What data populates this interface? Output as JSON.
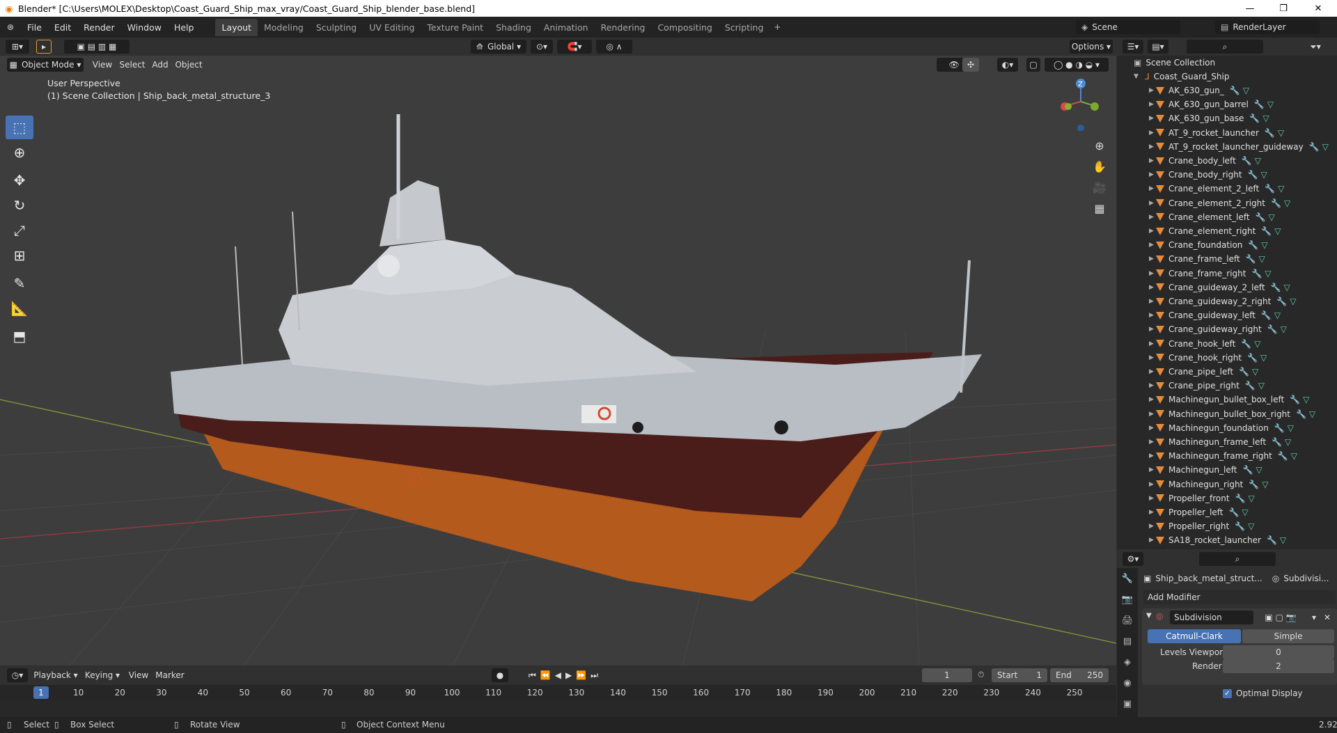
{
  "window": {
    "title": "Blender* [C:\\Users\\MOLEX\\Desktop\\Coast_Guard_Ship_max_vray/Coast_Guard_Ship_blender_base.blend]"
  },
  "menus": [
    "File",
    "Edit",
    "Render",
    "Window",
    "Help"
  ],
  "workspaces": [
    "Layout",
    "Modeling",
    "Sculpting",
    "UV Editing",
    "Texture Paint",
    "Shading",
    "Animation",
    "Rendering",
    "Compositing",
    "Scripting"
  ],
  "active_workspace": "Layout",
  "scene": {
    "name": "Scene",
    "render_layer": "RenderLayer"
  },
  "viewport_header": {
    "transform_orientation": "Global",
    "options": "Options",
    "mode": "Object Mode",
    "menus": [
      "View",
      "Select",
      "Add",
      "Object"
    ]
  },
  "viewport": {
    "perspective": "User Perspective",
    "collection_info": "(1) Scene Collection | Ship_back_metal_structure_3",
    "gizmo_axis": "Z"
  },
  "outliner": {
    "root": "Scene Collection",
    "collection": "Coast_Guard_Ship",
    "items": [
      "AK_630_gun_",
      "AK_630_gun_barrel",
      "AK_630_gun_base",
      "AT_9_rocket_launcher",
      "AT_9_rocket_launcher_guideway",
      "Crane_body_left",
      "Crane_body_right",
      "Crane_element_2_left",
      "Crane_element_2_right",
      "Crane_element_left",
      "Crane_element_right",
      "Crane_foundation",
      "Crane_frame_left",
      "Crane_frame_right",
      "Crane_guideway_2_left",
      "Crane_guideway_2_right",
      "Crane_guideway_left",
      "Crane_guideway_right",
      "Crane_hook_left",
      "Crane_hook_right",
      "Crane_pipe_left",
      "Crane_pipe_right",
      "Machinegun_bullet_box_left",
      "Machinegun_bullet_box_right",
      "Machinegun_foundation",
      "Machinegun_frame_left",
      "Machinegun_frame_right",
      "Machinegun_left",
      "Machinegun_right",
      "Propeller_front",
      "Propeller_left",
      "Propeller_right",
      "SA18_rocket_launcher"
    ]
  },
  "properties": {
    "object_name": "Ship_back_metal_struct...",
    "modifier_short": "Subdivisi...",
    "add_modifier": "Add Modifier",
    "modifier_name": "Subdivision",
    "mode_a": "Catmull-Clark",
    "mode_b": "Simple",
    "levels_label": "Levels Viewport",
    "levels_value": "0",
    "render_label": "Render",
    "render_value": "2",
    "optimal_display": "Optimal Display"
  },
  "timeline": {
    "menus": [
      "Playback",
      "Keying",
      "View",
      "Marker"
    ],
    "current_frame": "1",
    "start_label": "Start",
    "start": "1",
    "end_label": "End",
    "end": "250",
    "ticks": [
      "1",
      "10",
      "20",
      "30",
      "40",
      "50",
      "60",
      "70",
      "80",
      "90",
      "100",
      "110",
      "120",
      "130",
      "140",
      "150",
      "160",
      "170",
      "180",
      "190",
      "200",
      "210",
      "220",
      "230",
      "240",
      "250"
    ]
  },
  "statusbar": {
    "select": "Select",
    "box_select": "Box Select",
    "rotate_view": "Rotate View",
    "context_menu": "Object Context Menu",
    "version": "2.92"
  }
}
